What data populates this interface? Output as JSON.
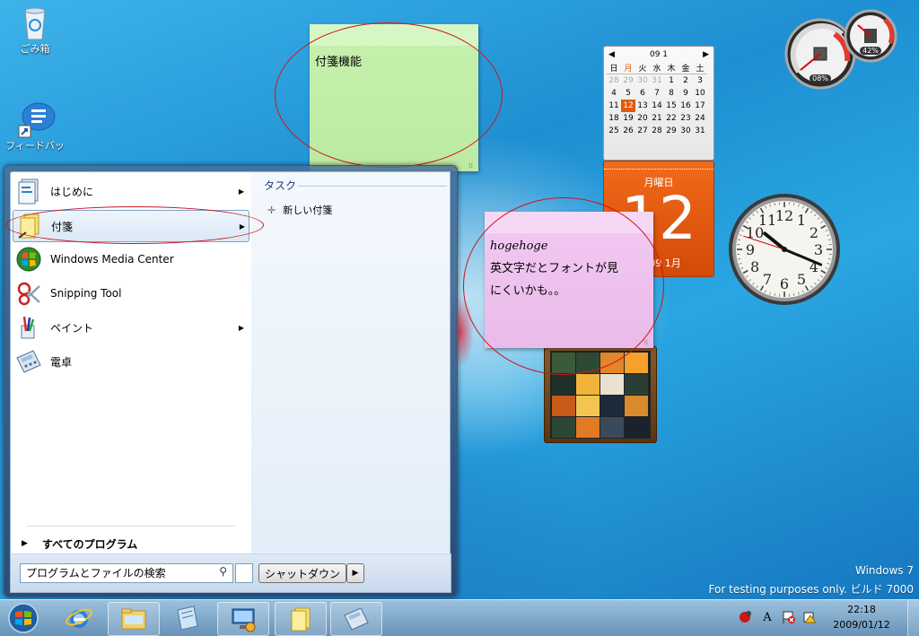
{
  "desktop": {
    "icons": [
      {
        "label": "ごみ箱",
        "icon": "recycle-bin-icon"
      },
      {
        "label": "フィードバッ",
        "icon": "feedback-icon"
      }
    ],
    "watermark": {
      "line1": "Windows 7",
      "line2": "For testing purposes only. ビルド 7000"
    }
  },
  "sticky_notes": [
    {
      "text_lines": [
        "付箋機能"
      ],
      "color": "#c8f2b4"
    },
    {
      "text_lines": [
        "hogehoge",
        "英文字だとフォントが見",
        "にくいかも。。"
      ],
      "color": "#f0c8f0"
    }
  ],
  "calendar_gadget": {
    "month_header": "09 1",
    "weekdays": [
      "日",
      "月",
      "火",
      "水",
      "木",
      "金",
      "土"
    ],
    "weeks": [
      [
        "28",
        "29",
        "30",
        "31",
        "1",
        "2",
        "3"
      ],
      [
        "4",
        "5",
        "6",
        "7",
        "8",
        "9",
        "10"
      ],
      [
        "11",
        "12",
        "13",
        "14",
        "15",
        "16",
        "17"
      ],
      [
        "18",
        "19",
        "20",
        "21",
        "22",
        "23",
        "24"
      ],
      [
        "25",
        "26",
        "27",
        "28",
        "29",
        "30",
        "31"
      ]
    ],
    "today": "12",
    "day_name": "月曜日",
    "day_number": "12",
    "footer": "2009 1月",
    "accent": "#e35a0d"
  },
  "cpu_gadget": {
    "cpu": "08%",
    "memory": "42%"
  },
  "clock_gadget": {
    "hour": 10,
    "minute": 18,
    "second": 48,
    "numbers": [
      "12",
      "1",
      "2",
      "3",
      "4",
      "5",
      "6",
      "7",
      "8",
      "9",
      "10",
      "11"
    ]
  },
  "start_menu": {
    "programs": [
      {
        "label": "はじめに",
        "icon": "getting-started-icon",
        "submenu": true
      },
      {
        "label": "付箋",
        "icon": "sticky-notes-icon",
        "submenu": true
      },
      {
        "label": "Windows Media Center",
        "icon": "media-center-icon",
        "submenu": false
      },
      {
        "label": "Snipping Tool",
        "icon": "scissors-icon",
        "submenu": false
      },
      {
        "label": "ペイント",
        "icon": "paint-icon",
        "submenu": true
      },
      {
        "label": "電卓",
        "icon": "calculator-icon",
        "submenu": false
      }
    ],
    "all_programs": "すべてのプログラム",
    "search_value": "プログラムとファイルの検索",
    "shutdown": "シャットダウン",
    "jump_list": {
      "heading": "タスク",
      "items": [
        "新しい付箋"
      ]
    }
  },
  "taskbar": {
    "pinned": [
      "start-orb",
      "internet-explorer",
      "explorer",
      "sticky-note-app",
      "remote-desktop",
      "sticky-notes",
      "calculator"
    ],
    "clock_time": "22:18",
    "clock_date": "2009/01/12",
    "tray_ime": "A"
  }
}
